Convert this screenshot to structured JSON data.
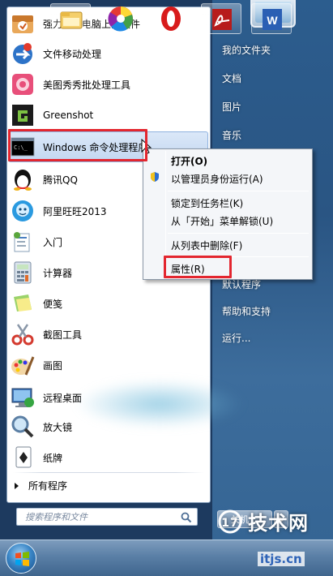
{
  "programs": [
    {
      "label": "强力卸载电脑上的软件",
      "icon": "uninstaller-icon"
    },
    {
      "label": "文件移动处理",
      "icon": "file-move-icon"
    },
    {
      "label": "美图秀秀批处理工具",
      "icon": "meitu-icon"
    },
    {
      "label": "Greenshot",
      "icon": "greenshot-icon"
    },
    {
      "label": "Windows 命令处理程序",
      "icon": "cmd-icon"
    },
    {
      "label": "腾讯QQ",
      "icon": "qq-icon"
    },
    {
      "label": "阿里旺旺2013",
      "icon": "aliwangwang-icon"
    },
    {
      "label": "入门",
      "icon": "getting-started-icon"
    },
    {
      "label": "计算器",
      "icon": "calculator-icon"
    },
    {
      "label": "便笺",
      "icon": "sticky-notes-icon"
    },
    {
      "label": "截图工具",
      "icon": "snipping-tool-icon"
    },
    {
      "label": "画图",
      "icon": "paint-icon"
    },
    {
      "label": "远程桌面",
      "icon": "remote-desktop-icon"
    },
    {
      "label": "放大镜",
      "icon": "magnifier-icon"
    },
    {
      "label": "纸牌",
      "icon": "solitaire-icon"
    }
  ],
  "all_programs": "所有程序",
  "search_placeholder": "搜索程序和文件",
  "right_menu": [
    "我的文件夹",
    "文档",
    "图片",
    "音乐",
    "默认程序",
    "帮助和支持",
    "运行..."
  ],
  "context_menu": {
    "open": "打开(O)",
    "run_as_admin": "以管理员身份运行(A)",
    "pin_taskbar": "锁定到任务栏(K)",
    "unpin_start": "从「开始」菜单解锁(U)",
    "remove_list": "从列表中删除(F)",
    "properties": "属性(R)"
  },
  "shutdown": "关机",
  "watermark": {
    "brand": "技术网",
    "url": "itjs.cn"
  },
  "colors": {
    "highlight_border": "#e3262f",
    "accent": "#2c5d8e"
  }
}
